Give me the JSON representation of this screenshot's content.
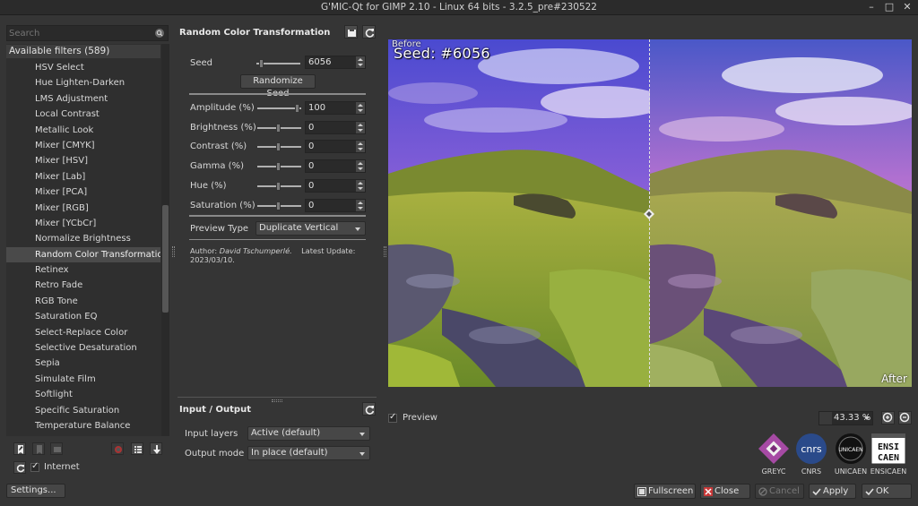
{
  "window": {
    "title": "G'MIC-Qt for GIMP 2.10 - Linux 64 bits - 3.2.5_pre#230522",
    "minimize": "–",
    "maximize": "□",
    "close": "✕"
  },
  "left": {
    "search_placeholder": "Search",
    "filters_header": "Available filters (589)",
    "filters": [
      "HSV Select",
      "Hue Lighten-Darken",
      "LMS Adjustment",
      "Local Contrast",
      "Metallic Look",
      "Mixer [CMYK]",
      "Mixer [HSV]",
      "Mixer [Lab]",
      "Mixer [PCA]",
      "Mixer [RGB]",
      "Mixer [YCbCr]",
      "Normalize Brightness",
      "Random Color Transformation",
      "Retinex",
      "Retro Fade",
      "RGB Tone",
      "Saturation EQ",
      "Select-Replace Color",
      "Selective Desaturation",
      "Sepia",
      "Simulate Film",
      "Softlight",
      "Specific Saturation",
      "Temperature Balance"
    ],
    "selected_filter": "Random Color Transformation",
    "internet_label": "Internet",
    "settings_label": "Settings..."
  },
  "params": {
    "title": "Random Color Transformation",
    "seed_label": "Seed",
    "seed_value": "6056",
    "randomize_label": "Randomize Seed",
    "sliders": [
      {
        "label": "Amplitude (%)",
        "value": "100",
        "fraction": 1.0
      },
      {
        "label": "Brightness (%)",
        "value": "0",
        "fraction": 0.5
      },
      {
        "label": "Contrast (%)",
        "value": "0",
        "fraction": 0.5
      },
      {
        "label": "Gamma (%)",
        "value": "0",
        "fraction": 0.5
      },
      {
        "label": "Hue (%)",
        "value": "0",
        "fraction": 0.5
      },
      {
        "label": "Saturation (%)",
        "value": "0",
        "fraction": 0.5
      }
    ],
    "preview_type_label": "Preview Type",
    "preview_type_value": "Duplicate Vertical",
    "author_label": "Author:",
    "author_name": "David Tschumperlé.",
    "update_label": "Latest Update:",
    "update_date": "2023/03/10."
  },
  "io": {
    "title": "Input / Output",
    "input_label": "Input layers",
    "input_value": "Active (default)",
    "output_label": "Output mode",
    "output_value": "In place (default)"
  },
  "preview": {
    "seed_overlay": "Seed:  #6056",
    "before_label": "Before",
    "after_label": "After",
    "preview_checkbox": "Preview",
    "zoom": "43.33 %"
  },
  "logos": [
    "GREYC",
    "CNRS",
    "UNICAEN",
    "ENSICAEN"
  ],
  "logo_text": {
    "cnrs": "cnrs",
    "unicaen": "UNICAEN",
    "ensicaen1": "ENSI",
    "ensicaen2": "CAEN"
  },
  "buttons": {
    "fullscreen": "Fullscreen",
    "close": "Close",
    "cancel": "Cancel",
    "apply": "Apply",
    "ok": "OK"
  },
  "colors": {
    "background": "#353535",
    "panel": "#2f2f2f",
    "selection": "#4a4a4a",
    "close_icon": "#d04040",
    "ok_icon": "#e0e0e0"
  }
}
